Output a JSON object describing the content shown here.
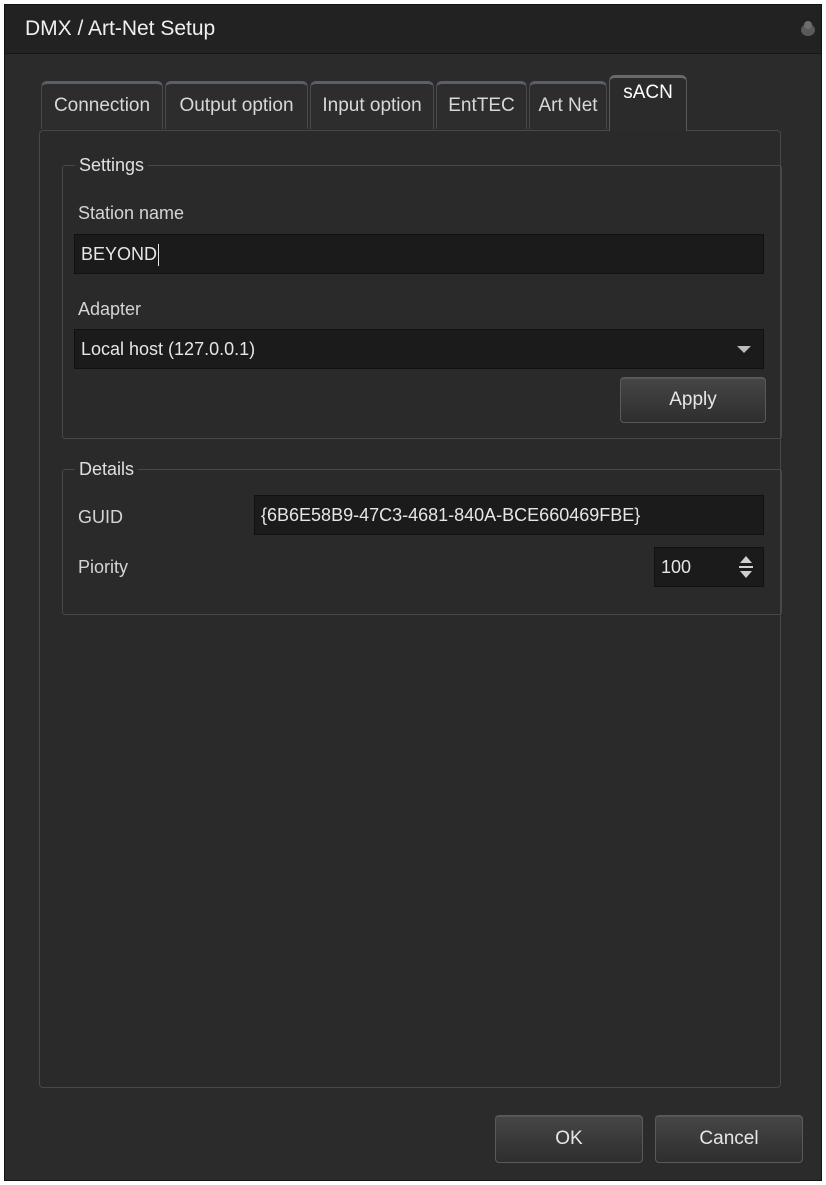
{
  "window": {
    "title": "DMX / Art-Net Setup"
  },
  "tabs": [
    {
      "label": "Connection",
      "active": false
    },
    {
      "label": "Output option",
      "active": false
    },
    {
      "label": "Input option",
      "active": false
    },
    {
      "label": "EntTEC",
      "active": false
    },
    {
      "label": "Art Net",
      "active": false
    },
    {
      "label": "sACN",
      "active": true
    }
  ],
  "settings": {
    "legend": "Settings",
    "station_name_label": "Station name",
    "station_name_value": "BEYOND",
    "adapter_label": "Adapter",
    "adapter_value": "Local host (127.0.0.1)",
    "apply_label": "Apply"
  },
  "details": {
    "legend": "Details",
    "guid_label": "GUID",
    "guid_value": "{6B6E58B9-47C3-4681-840A-BCE660469FBE}",
    "priority_label": "Piority",
    "priority_value": "100"
  },
  "footer": {
    "ok_label": "OK",
    "cancel_label": "Cancel"
  },
  "icons": {
    "title_icon": "app-icon",
    "dropdown": "chevron-down-icon",
    "spinner": "spin-arrows-icon"
  },
  "colors": {
    "window_bg": "#2b2b2b",
    "input_bg": "#1b1b1b",
    "text": "#d4d4d4"
  }
}
